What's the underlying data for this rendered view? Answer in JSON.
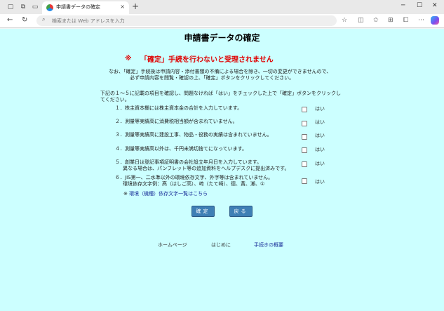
{
  "browser": {
    "tab_title": "申請書データの確定",
    "tab_close": "×",
    "new_tab": "+",
    "address_placeholder": "検索または Web アドレスを入力",
    "icons": [
      "sidebar-icon",
      "tabs-icon",
      "favicon",
      "back-icon",
      "refresh-icon",
      "search-icon",
      "favorite-icon",
      "split-screen-icon",
      "favorites-list-icon",
      "collections-icon",
      "extensions-icon",
      "copilot-icon"
    ],
    "window_controls": [
      "minimize",
      "maximize",
      "close"
    ]
  },
  "page": {
    "title": "申請書データの確定",
    "warning_mark": "※",
    "warning": "「確定」手続を行わないと受理されません",
    "note_line1": "なお、「確定」手続後は申請内容・添付書類の不備による場合を除き、一切の変更ができませんので、",
    "note_line2": "必ず申請内容を閲覧・確認の上、「確定」ボタンをクリックしてください。",
    "instruction_line1": "下記の１～５に記載の項目を確認し、問題なければ「はい」をチェックした上で「確定」ボタンをクリックし",
    "instruction_line2": "てください。",
    "items": [
      {
        "text": "１．株主資本欄には株主資本金の合計を入力しています。",
        "sub": "",
        "yes": "はい"
      },
      {
        "text": "２．測量等実績高に消費税相当額が含まれていません。",
        "sub": "",
        "yes": "はい"
      },
      {
        "text": "３．測量等実績高に建設工事、物品・役務の実績は含まれていません。",
        "sub": "",
        "yes": "はい"
      },
      {
        "text": "４．測量等実績高以外は、千円未満切捨てになっています。",
        "sub": "",
        "yes": "はい"
      },
      {
        "text": "５．創業日は登記事項証明書の会社設立年月日を入力しています。",
        "sub": "異なる場合は、パンフレット等の追加資料をヘルプデスクに提出済みです。",
        "yes": "はい"
      },
      {
        "text": "６．JIS第一、二水準以外の環境依存文字、外字等は含まれていません。",
        "sub": "環境依存文字例：髙（はしご高）、﨑（たて崎）、德、黃、瀨、①",
        "yes": "はい"
      }
    ],
    "env_link_mark": "※",
    "env_link": "環境（機種）依存文字一覧はこちら",
    "buttons": {
      "confirm": "確定",
      "back": "戻る"
    },
    "footer": {
      "home": "ホームページ",
      "intro": "はじめに",
      "overview": "手続きの概要"
    }
  }
}
